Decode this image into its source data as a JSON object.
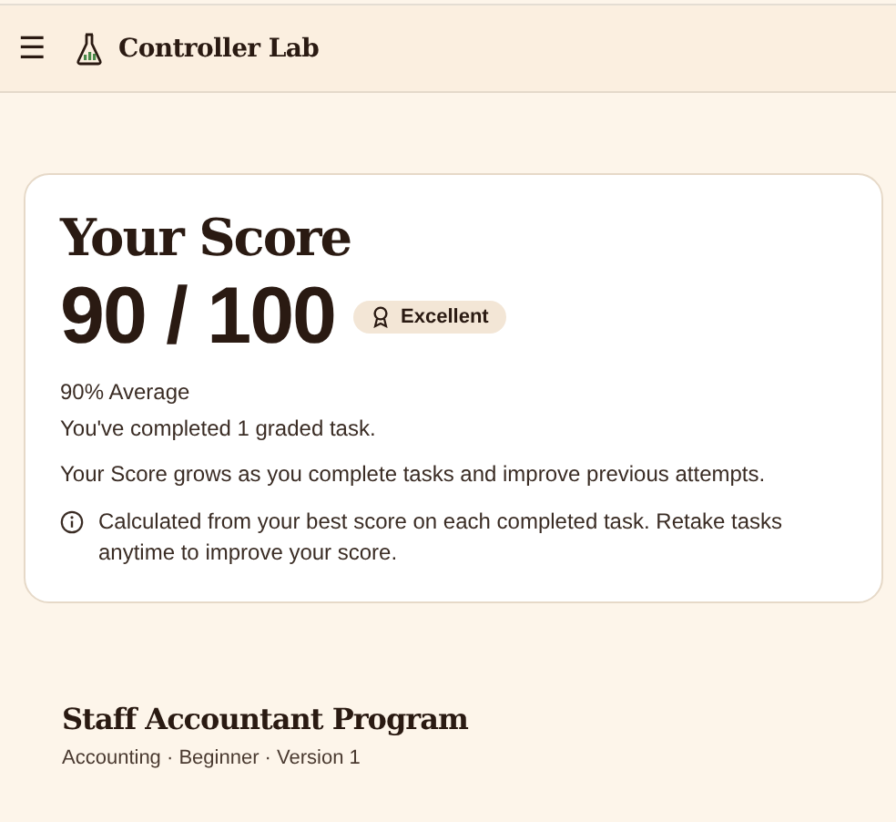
{
  "header": {
    "menu_icon": "☰",
    "title": "Controller Lab"
  },
  "score_card": {
    "title": "Your Score",
    "score": "90 / 100",
    "badge": "Excellent",
    "average": "90% Average",
    "completed": "You've completed 1 graded task.",
    "description": "Your Score grows as you complete tasks and improve previous attempts.",
    "note": "Calculated from your best score on each completed task. Retake tasks anytime to improve your score."
  },
  "program": {
    "title": "Staff Accountant Program",
    "meta": "Accounting · Beginner · Version 1"
  }
}
